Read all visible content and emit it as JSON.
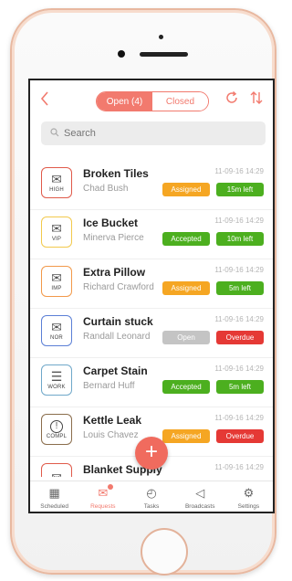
{
  "header": {
    "tabs": [
      {
        "label": "Open (4)",
        "active": true
      },
      {
        "label": "Closed",
        "active": false
      }
    ],
    "back_icon": "chevron-left-icon",
    "refresh_icon": "refresh-icon",
    "sort_icon": "sort-arrows-icon",
    "accent": "#f27a6e"
  },
  "search": {
    "placeholder": "Search"
  },
  "requests": [
    {
      "title": "Broken Tiles",
      "person": "Chad Bush",
      "time": "11-09-16 14:29",
      "tag": "HIGH",
      "icon": "envelope-icon",
      "border": "#e05a4a",
      "status": "Assigned",
      "status_color": "#f5a623",
      "remaining": "15m left",
      "remaining_color": "#4caf1f"
    },
    {
      "title": "Ice Bucket",
      "person": "Minerva Pierce",
      "time": "11-09-16 14:29",
      "tag": "VIP",
      "icon": "envelope-icon",
      "border": "#f2c94c",
      "status": "Accepted",
      "status_color": "#4caf1f",
      "remaining": "10m left",
      "remaining_color": "#4caf1f"
    },
    {
      "title": "Extra Pillow",
      "person": "Richard Crawford",
      "time": "11-09-16 14:29",
      "tag": "IMP",
      "icon": "envelope-icon",
      "border": "#f2994a",
      "status": "Assigned",
      "status_color": "#f5a623",
      "remaining": "5m left",
      "remaining_color": "#4caf1f"
    },
    {
      "title": "Curtain stuck",
      "person": "Randall Leonard",
      "time": "11-09-16 14:29",
      "tag": "NOR",
      "icon": "envelope-icon",
      "border": "#5b7fd6",
      "status": "Open",
      "status_color": "#c4c4c4",
      "remaining": "Overdue",
      "remaining_color": "#e53935"
    },
    {
      "title": "Carpet Stain",
      "person": "Bernard Huff",
      "time": "11-09-16 14:29",
      "tag": "WORK",
      "icon": "document-icon",
      "border": "#6fa8c9",
      "status": "Accepted",
      "status_color": "#4caf1f",
      "remaining": "5m left",
      "remaining_color": "#4caf1f"
    },
    {
      "title": "Kettle Leak",
      "person": "Louis Chavez",
      "time": "11-09-16 14:29",
      "tag": "COMPL",
      "icon": "alert-icon",
      "border": "#8a6d4c",
      "status": "Assigned",
      "status_color": "#f5a623",
      "remaining": "Overdue",
      "remaining_color": "#e53935"
    },
    {
      "title": "Blanket Supply",
      "person": "",
      "time": "11-09-16 14:29",
      "tag": "",
      "icon": "envelope-icon",
      "border": "#e05a4a",
      "status": "",
      "status_color": "#f5a623",
      "remaining": "",
      "remaining_color": "#4caf1f"
    }
  ],
  "fab": {
    "label": "+",
    "icon": "plus-icon"
  },
  "tabbar": [
    {
      "label": "Scheduled",
      "icon": "calendar-icon",
      "active": false
    },
    {
      "label": "Requests",
      "icon": "requests-icon",
      "active": true
    },
    {
      "label": "Tasks",
      "icon": "timer-icon",
      "active": false
    },
    {
      "label": "Broadcasts",
      "icon": "megaphone-icon",
      "active": false
    },
    {
      "label": "Settings",
      "icon": "gear-icon",
      "active": false
    }
  ]
}
